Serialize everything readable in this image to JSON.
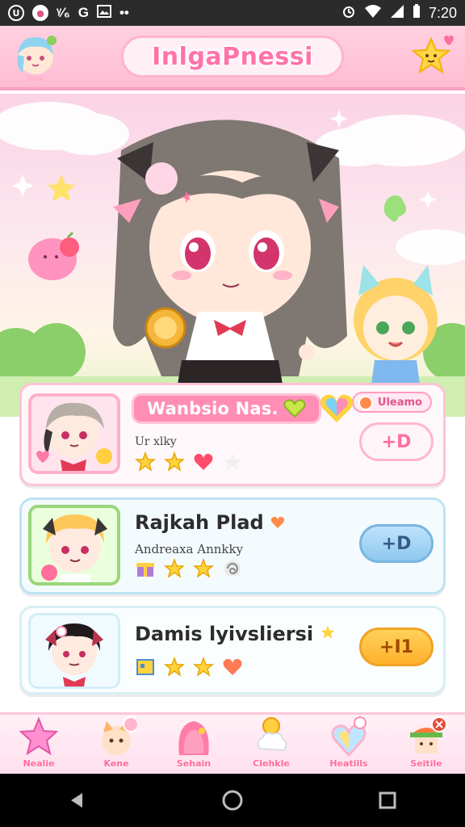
{
  "status_bar": {
    "left_icons": [
      "circle-u-icon",
      "circle-o-icon",
      "fx-icon",
      "g-icon",
      "photo-icon",
      "more-icon"
    ],
    "fx_label": "ᵞ⁄₆",
    "g_label": "G",
    "more_label": "••",
    "time": "7:20"
  },
  "header": {
    "title": "InlgaPnessi"
  },
  "cards": [
    {
      "name": "Wanbsio Nas.",
      "subtitle": "Ur xlky",
      "badge": "Uleamo",
      "action": "+D",
      "icons": [
        "star-icon",
        "star-icon",
        "heart-icon",
        "faded-star-icon"
      ]
    },
    {
      "name": "Rajkah Plad",
      "subtitle": "Andreaxa Annkky",
      "action": "+D",
      "icons": [
        "gift-icon",
        "star-icon",
        "star-icon",
        "swirl-icon"
      ]
    },
    {
      "name": "Damis lyivsliersi",
      "action": "+I1",
      "icons": [
        "card-icon",
        "star-icon",
        "star-icon",
        "heart-icon"
      ]
    }
  ],
  "tabs": [
    {
      "label": "Nealie",
      "icon": "star-icon"
    },
    {
      "label": "Kene",
      "icon": "cat-icon"
    },
    {
      "label": "Sehain",
      "icon": "hair-icon"
    },
    {
      "label": "Clehkle",
      "icon": "cloud-icon"
    },
    {
      "label": "Heatills",
      "icon": "heart-charm-icon"
    },
    {
      "label": "Seitile",
      "icon": "hat-icon"
    }
  ],
  "nav": [
    "back-icon",
    "home-icon",
    "recents-icon"
  ],
  "colors": {
    "primary_pink": "#ff8db6",
    "header_bg": "#ffbcd3",
    "blue_button": "#8ec8ef",
    "gold_button": "#ffb12c"
  }
}
